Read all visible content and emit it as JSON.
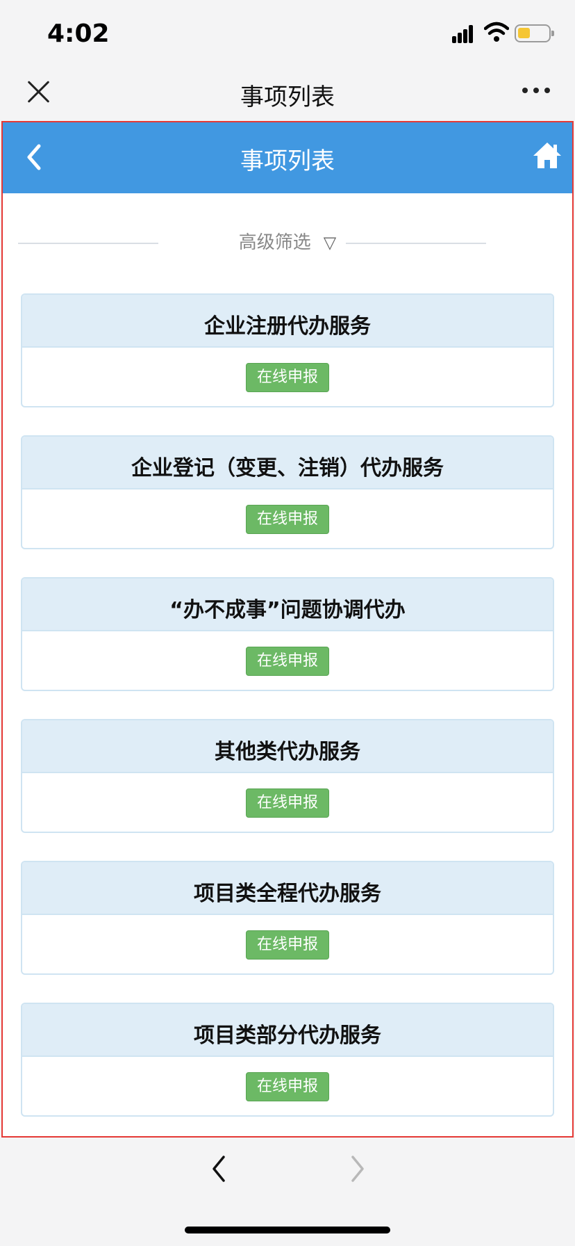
{
  "status_bar": {
    "time": "4:02",
    "battery_color": "#f5c634"
  },
  "wechat_bar": {
    "title": "事项列表",
    "close_icon": "close-icon",
    "more_icon": "more-icon"
  },
  "page_header": {
    "title": "事项列表",
    "back_icon": "chevron-left-icon",
    "home_icon": "home-icon",
    "color": "#4198e1"
  },
  "filter": {
    "label": "高级筛选",
    "icon": "▽"
  },
  "cards": [
    {
      "title": "企业注册代办服务",
      "button": "在线申报"
    },
    {
      "title": "企业登记（变更、注销）代办服务",
      "button": "在线申报"
    },
    {
      "title": "“办不成事”问题协调代办",
      "button": "在线申报"
    },
    {
      "title": "其他类代办服务",
      "button": "在线申报"
    },
    {
      "title": "项目类全程代办服务",
      "button": "在线申报"
    },
    {
      "title": "项目类部分代办服务",
      "button": "在线申报"
    }
  ],
  "bottom_bar": {
    "back_icon": "chevron-left-icon",
    "forward_icon": "chevron-right-icon"
  }
}
